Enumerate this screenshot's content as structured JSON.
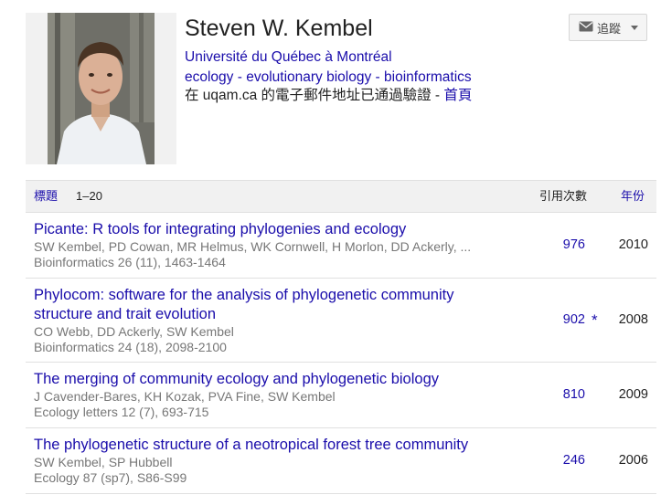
{
  "profile": {
    "name": "Steven W. Kembel",
    "affiliation": "Université du Québec à Montréal",
    "interests": [
      "ecology",
      "evolutionary biology",
      "bioinformatics"
    ],
    "interest_separator": " - ",
    "verified_text": "在 uqam.ca 的電子郵件地址已通過驗證",
    "verified_separator": " - ",
    "homepage_label": "首頁",
    "follow_label": "追蹤"
  },
  "table": {
    "header": {
      "title_label": "標題",
      "range": "1–20",
      "cited_by_label": "引用次數",
      "year_label": "年份"
    },
    "rows": [
      {
        "title_lines": [
          "Picante: R tools for integrating phylogenies and ecology"
        ],
        "authors": "SW Kembel, PD Cowan, MR Helmus, WK Cornwell, H Morlon, DD Ackerly, ...",
        "venue": "Bioinformatics 26 (11), 1463-1464",
        "citations": "976",
        "star": "",
        "year": "2010"
      },
      {
        "title_lines": [
          "Phylocom: software for the analysis of phylogenetic community",
          "structure and trait evolution"
        ],
        "authors": "CO Webb, DD Ackerly, SW Kembel",
        "venue": "Bioinformatics 24 (18), 2098-2100",
        "citations": "902",
        "star": "*",
        "year": "2008"
      },
      {
        "title_lines": [
          "The merging of community ecology and phylogenetic biology"
        ],
        "authors": "J Cavender-Bares, KH Kozak, PVA Fine, SW Kembel",
        "venue": "Ecology letters 12 (7), 693-715",
        "citations": "810",
        "star": "",
        "year": "2009"
      },
      {
        "title_lines": [
          "The phylogenetic structure of a neotropical forest tree community"
        ],
        "authors": "SW Kembel, SP Hubbell",
        "venue": "Ecology 87 (sp7), S86-S99",
        "citations": "246",
        "star": "",
        "year": "2006"
      }
    ]
  },
  "colors": {
    "link": "#1a0dab",
    "text": "#222222",
    "muted": "#777777",
    "header_bg": "#f1f1f1",
    "divider": "#e0e0e0"
  }
}
